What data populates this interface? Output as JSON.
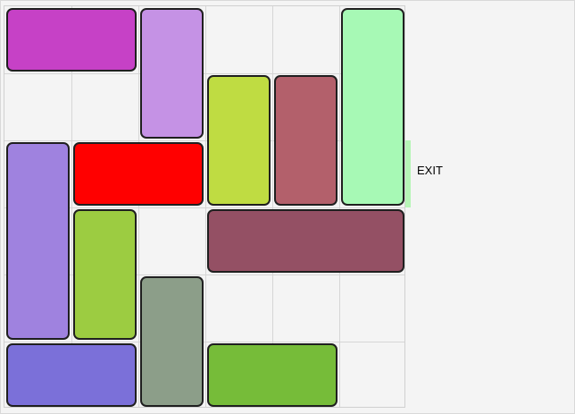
{
  "exit": {
    "label": "EXIT",
    "color": "#b6f5b6"
  },
  "board": {
    "rows": 6,
    "cols": 6,
    "target_block_id": "target-red",
    "exit_row": 2,
    "exit_side": "right"
  },
  "blocks": [
    {
      "id": "block-magenta",
      "row": 0,
      "col": 0,
      "width": 2,
      "height": 1,
      "color": "#c641c6"
    },
    {
      "id": "block-lavender",
      "row": 0,
      "col": 2,
      "width": 1,
      "height": 2,
      "color": "#c592e5"
    },
    {
      "id": "block-mint",
      "row": 0,
      "col": 5,
      "width": 1,
      "height": 3,
      "color": "#a7f9b5"
    },
    {
      "id": "block-lime-yellow",
      "row": 1,
      "col": 3,
      "width": 1,
      "height": 2,
      "color": "#bfdc42"
    },
    {
      "id": "block-rose",
      "row": 1,
      "col": 4,
      "width": 1,
      "height": 2,
      "color": "#b3606b"
    },
    {
      "id": "block-purple",
      "row": 2,
      "col": 0,
      "width": 1,
      "height": 3,
      "color": "#9f82df"
    },
    {
      "id": "target-red",
      "row": 2,
      "col": 1,
      "width": 2,
      "height": 1,
      "color": "#ff0000"
    },
    {
      "id": "block-plum",
      "row": 3,
      "col": 3,
      "width": 3,
      "height": 1,
      "color": "#945064"
    },
    {
      "id": "block-green",
      "row": 3,
      "col": 1,
      "width": 1,
      "height": 2,
      "color": "#9ccc41"
    },
    {
      "id": "block-sage",
      "row": 4,
      "col": 2,
      "width": 1,
      "height": 2,
      "color": "#8c9e89"
    },
    {
      "id": "block-blue-violet",
      "row": 5,
      "col": 0,
      "width": 2,
      "height": 1,
      "color": "#7b70d9"
    },
    {
      "id": "block-grass",
      "row": 5,
      "col": 3,
      "width": 2,
      "height": 1,
      "color": "#76bc39"
    }
  ]
}
